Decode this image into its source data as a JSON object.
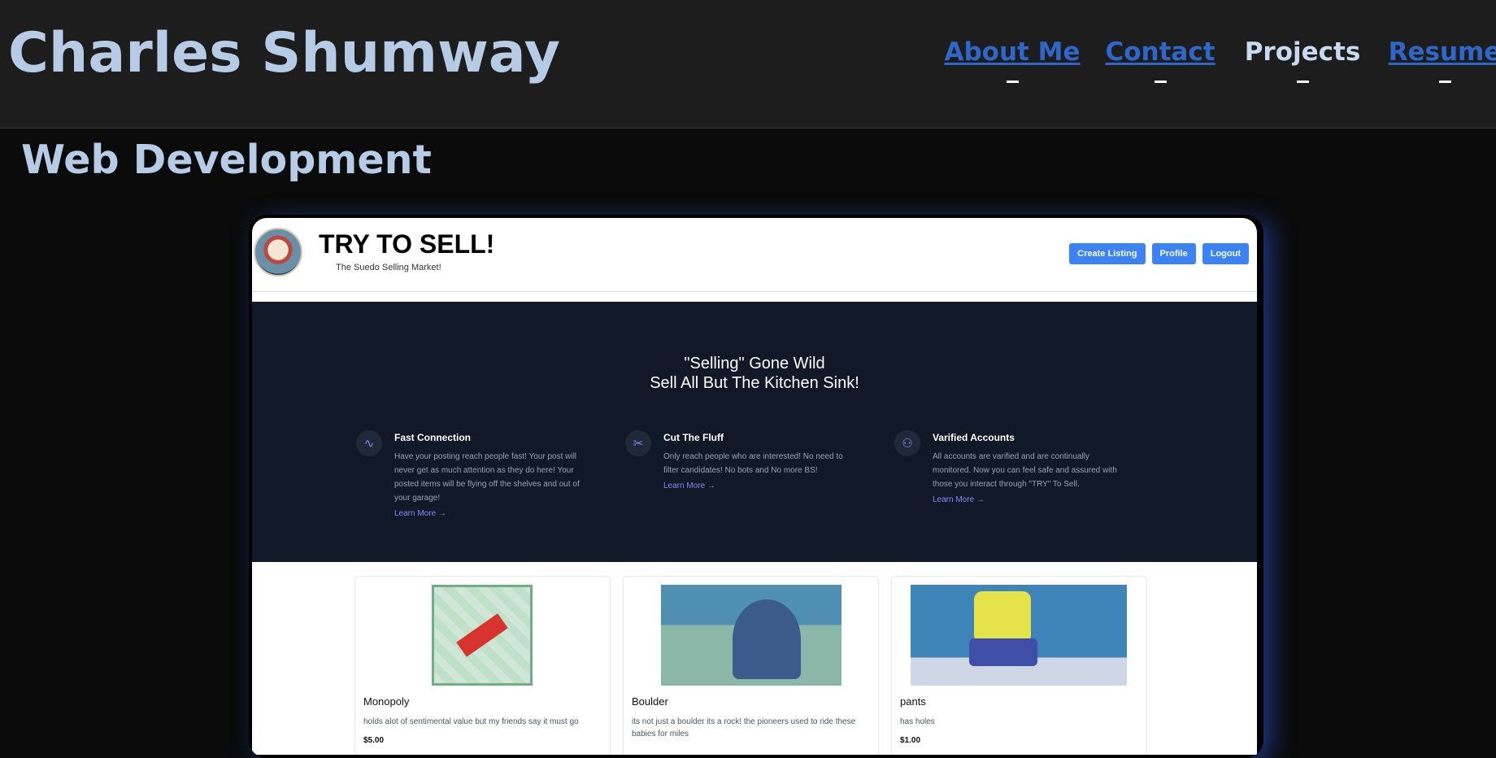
{
  "site": {
    "title": "Charles Shumway"
  },
  "nav": [
    {
      "label": "About Me"
    },
    {
      "label": "Contact"
    },
    {
      "label": "Projects",
      "current": true
    },
    {
      "label": "Resume"
    }
  ],
  "section": {
    "title": "Web Development"
  },
  "app": {
    "name": "TRY TO SELL!",
    "tagline": "The Suedo Selling Market!",
    "buttons": {
      "create": "Create Listing",
      "profile": "Profile",
      "logout": "Logout"
    },
    "hero": {
      "line1": "\"Selling\" Gone Wild",
      "line2": "Sell All But The Kitchen Sink!"
    },
    "features": [
      {
        "icon": "activity-icon",
        "title": "Fast Connection",
        "text": "Have your posting reach people fast! Your post will never get as much attention as they do here! Your posted items will be flying off the shelves and out of your garage!",
        "link": "Learn More →"
      },
      {
        "icon": "scissors-icon",
        "title": "Cut The Fluff",
        "text": "Only reach people who are interested! No need to filter candidates! No bots and No more BS!",
        "link": "Learn More →"
      },
      {
        "icon": "user-icon",
        "title": "Varified Accounts",
        "text": "All accounts are varified and are continually monitored. Now you can feel safe and assured with those you interact through \"TRY\" To Sell.",
        "link": "Learn More →"
      }
    ],
    "listings": [
      {
        "name": "Monopoly",
        "desc": "holds alot of sentimental value but my friends say it must go",
        "price": "$5.00"
      },
      {
        "name": "Boulder",
        "desc": "its not just a boulder its a rock! the pioneers used to ride these babies for miles",
        "price": ""
      },
      {
        "name": "pants",
        "desc": "has holes",
        "price": "$1.00"
      }
    ]
  },
  "colors": {
    "accent": "#3b82f6",
    "title": "#b6cbe6",
    "link": "#2f67c9",
    "hero_bg": "#111827"
  }
}
